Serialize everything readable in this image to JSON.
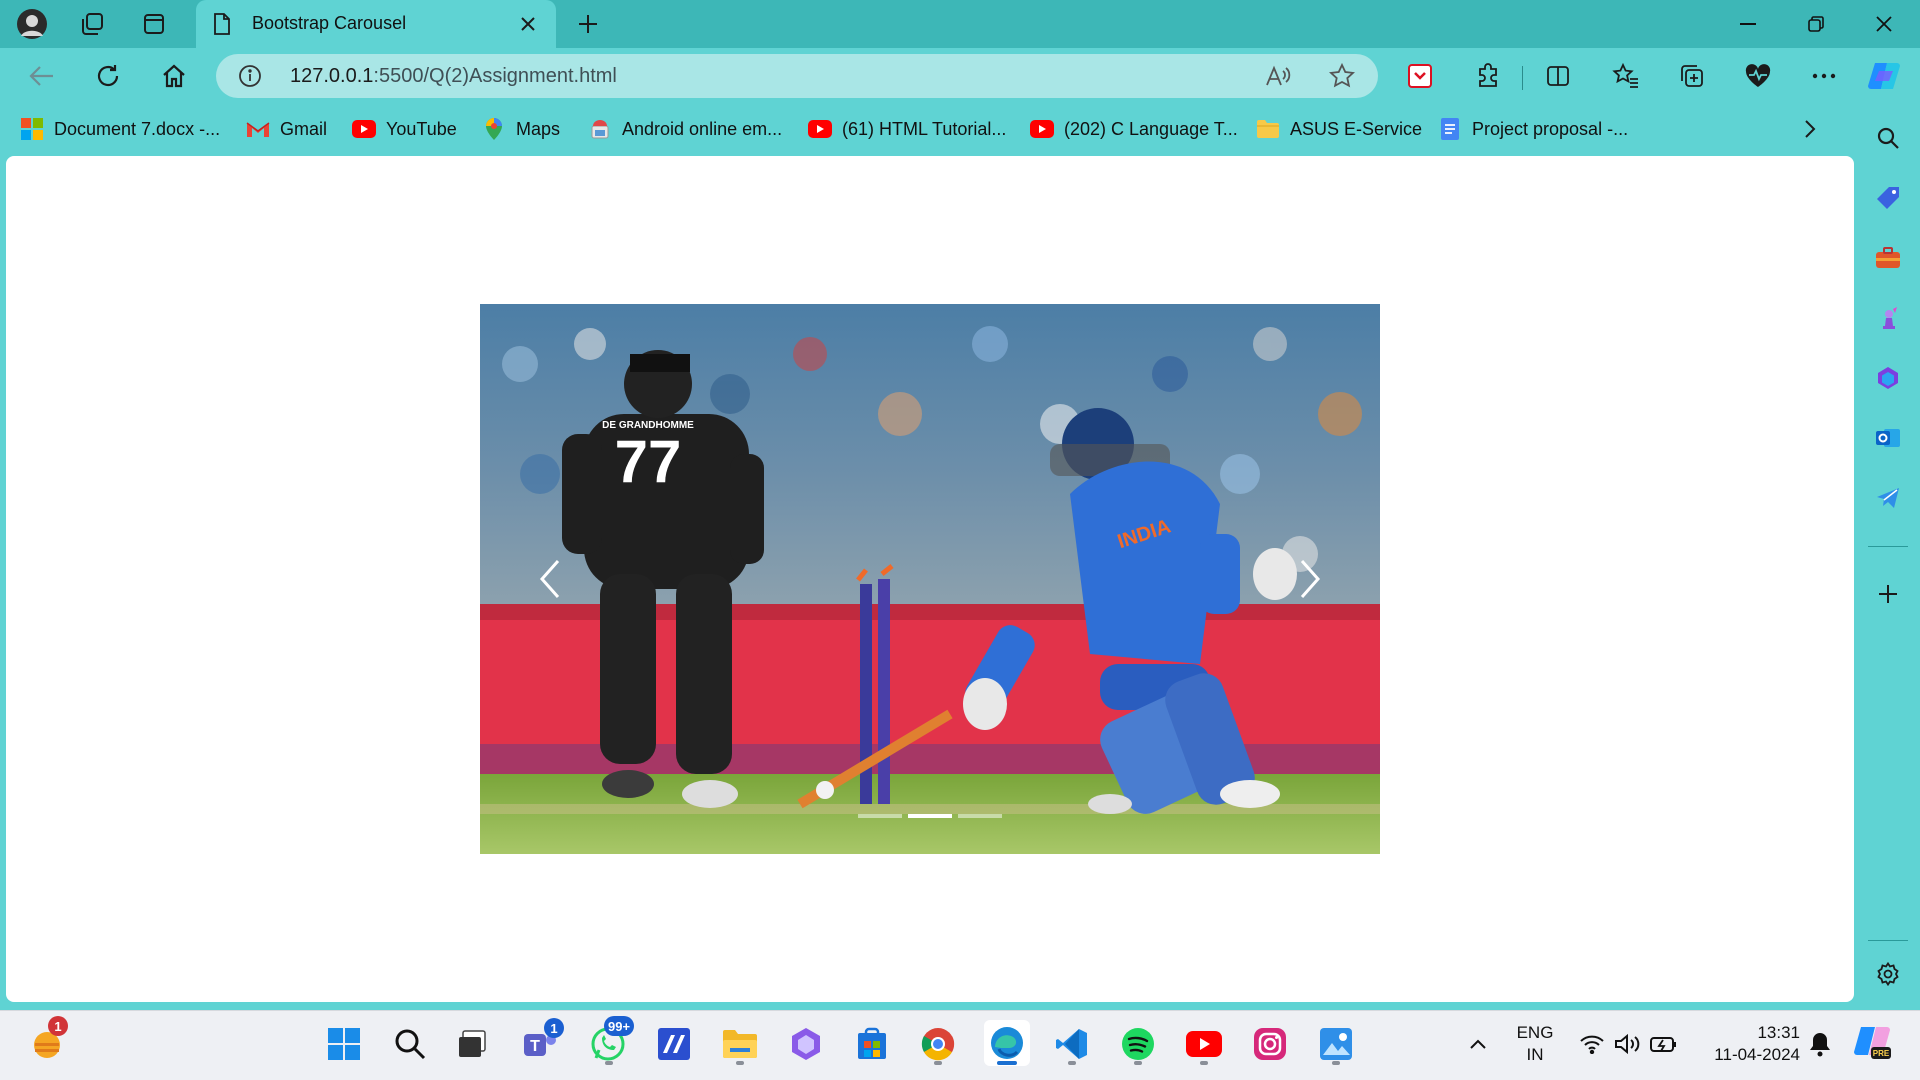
{
  "browser": {
    "tab": {
      "title": "Bootstrap Carousel"
    },
    "address": {
      "host": "127.0.0.1",
      "rest": ":5500/Q(2)Assignment.html"
    }
  },
  "favorites": [
    {
      "label": "Document 7.docx -...",
      "icon": "windows-logo-icon"
    },
    {
      "label": "Gmail",
      "icon": "gmail-icon"
    },
    {
      "label": "YouTube",
      "icon": "youtube-icon"
    },
    {
      "label": "Maps",
      "icon": "maps-pin-icon"
    },
    {
      "label": "Android online em...",
      "icon": "android-emulator-icon"
    },
    {
      "label": "(61) HTML Tutorial...",
      "icon": "youtube-icon"
    },
    {
      "label": "(202) C Language T...",
      "icon": "youtube-icon"
    },
    {
      "label": "ASUS E-Service",
      "icon": "folder-icon"
    },
    {
      "label": "Project proposal -...",
      "icon": "google-docs-icon"
    }
  ],
  "carousel": {
    "jersey_number": "77",
    "jersey_name": "DE GRANDHOMME",
    "shirt_text": "INDIA",
    "slide_count": 3,
    "active_slide": 2
  },
  "taskbar": {
    "weather_badge": "1",
    "teams_badge": "1",
    "whatsapp_badge": "99+",
    "language": "ENG",
    "region": "IN",
    "time": "13:31",
    "date": "11-04-2024"
  },
  "colors": {
    "browser_frame": "#5fd3d3",
    "tab_strip": "#3db7b7",
    "address_field": "#a9e6e6",
    "page_background": "#ffffff",
    "taskbar": "#eef0f4"
  }
}
